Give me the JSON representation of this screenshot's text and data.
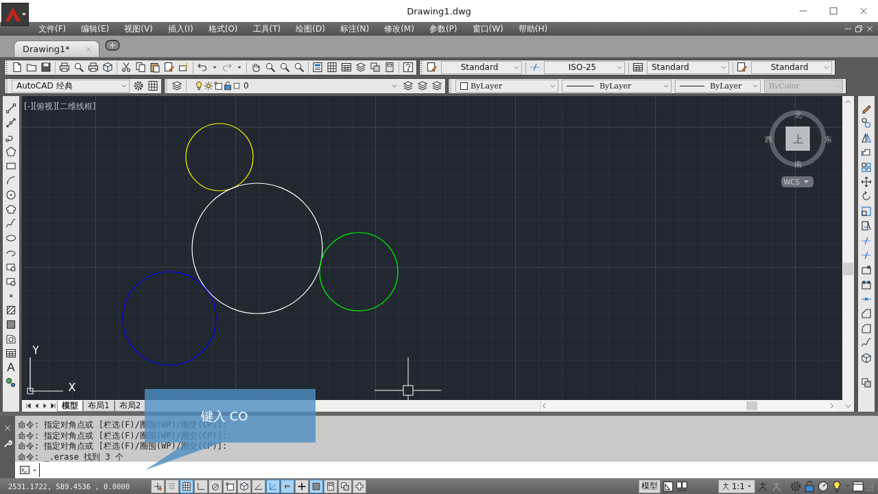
{
  "window": {
    "title": "Drawing1.dwg"
  },
  "menu": [
    "文件(F)",
    "编辑(E)",
    "视图(V)",
    "插入(I)",
    "格式(O)",
    "工具(T)",
    "绘图(D)",
    "标注(N)",
    "修改(M)",
    "参数(P)",
    "窗口(W)",
    "帮助(H)"
  ],
  "doc_tabs": [
    {
      "label": "Drawing1*",
      "selected": true
    }
  ],
  "styles_toolbar": {
    "text_style": "Standard",
    "dim_style": "ISO-25",
    "table_style": "Standard",
    "mleader_style": "Standard"
  },
  "workspace": {
    "value": "AutoCAD 经典"
  },
  "layer": {
    "name": "0"
  },
  "properties": [
    {
      "kind": "color",
      "value": "ByLayer",
      "disabled": false
    },
    {
      "kind": "linetype",
      "value": "ByLayer",
      "disabled": false
    },
    {
      "kind": "lineweight",
      "value": "ByLayer",
      "disabled": false
    },
    {
      "kind": "plotstyle",
      "value": "ByColor",
      "disabled": true
    }
  ],
  "draw_toolbar": {
    "text_tool": "A"
  },
  "viewport": {
    "label": "[-][俯视][二维线框]"
  },
  "circles": [
    {
      "color": "#ffff00"
    },
    {
      "color": "#ffffff"
    },
    {
      "color": "#00ff00"
    },
    {
      "color": "#0000ff"
    }
  ],
  "ucs": {
    "x": "X",
    "y": "Y"
  },
  "viewcube": {
    "north": "北",
    "west": "西",
    "east": "东",
    "south": "南",
    "face": "上",
    "wcs": "WCS"
  },
  "layout_tabs": [
    {
      "label": "模型",
      "selected": true
    },
    {
      "label": "布局1",
      "selected": false
    },
    {
      "label": "布局2",
      "selected": false
    }
  ],
  "command": {
    "history": [
      "命令: 指定对角点或 [栏选(F)/圈围(WP)/圈交(CP)]:",
      "命令: 指定对角点或 [栏选(F)/圈围(WP)/圈交(CP)]:",
      "命令: 指定对角点或 [栏选(F)/圈围(WP)/圈交(CP)]:",
      "命令: _.erase 找到 3 个"
    ]
  },
  "callout": {
    "text": "键入 CO"
  },
  "status": {
    "coordinates": "2531.1722, 589.4536 , 0.0000",
    "toggles": [
      {
        "on": false
      },
      {
        "on": false
      },
      {
        "on": true
      },
      {
        "on": false
      },
      {
        "on": false
      },
      {
        "on": false
      },
      {
        "on": false
      },
      {
        "on": false
      },
      {
        "on": true
      },
      {
        "on": true
      },
      {
        "on": false
      },
      {
        "on": true
      },
      {
        "on": false
      },
      {
        "on": false
      },
      {
        "on": false
      }
    ],
    "space": "模型",
    "annotation_scale": "1:1"
  }
}
